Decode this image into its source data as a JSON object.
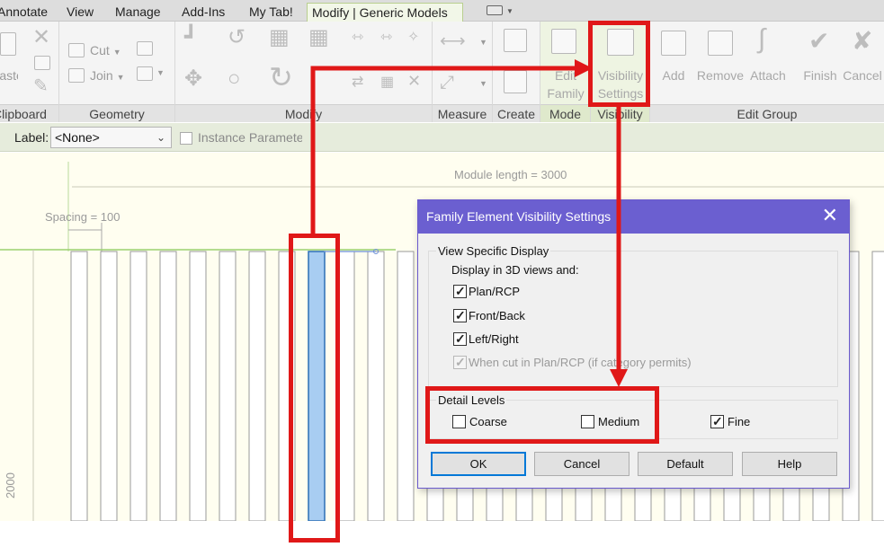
{
  "ribbon_tabs": [
    {
      "label": "Annotate"
    },
    {
      "label": "View"
    },
    {
      "label": "Manage"
    },
    {
      "label": "Add-Ins"
    },
    {
      "label": "My Tab!"
    },
    {
      "label": "Modify | Generic Models",
      "active": true
    }
  ],
  "ribbon": {
    "panels": {
      "clipboard": "Clipboard",
      "geometry": "Geometry",
      "modify": "Modify",
      "measure": "Measure",
      "create": "Create",
      "mode": "Mode",
      "visibility": "Visibility",
      "edit_group": "Edit Group"
    },
    "buttons": {
      "paste": "Paste",
      "cut": "Cut",
      "join": "Join",
      "edit_family_1": "Edit",
      "edit_family_2": "Family",
      "visibility_settings_1": "Visibility",
      "visibility_settings_2": "Settings",
      "add": "Add",
      "remove": "Remove",
      "attach": "Attach",
      "finish": "Finish",
      "cancel": "Cancel"
    }
  },
  "options_bar": {
    "label_caption": "Label:",
    "label_value": "<None>",
    "instance_parameter": "Instance Parameter"
  },
  "canvas": {
    "module_length": "Module length = 3000",
    "spacing": "Spacing = 100",
    "height_dim": "2000"
  },
  "dialog": {
    "title": "Family Element Visibility Settings",
    "view_specific": {
      "group_label": "View Specific Display",
      "display_caption": "Display in 3D views and:",
      "options": [
        {
          "label": "Plan/RCP",
          "checked": true,
          "enabled": true
        },
        {
          "label": "Front/Back",
          "checked": true,
          "enabled": true
        },
        {
          "label": "Left/Right",
          "checked": true,
          "enabled": true
        },
        {
          "label": "When cut in Plan/RCP (if category permits)",
          "checked": true,
          "enabled": false
        }
      ]
    },
    "detail_levels": {
      "group_label": "Detail Levels",
      "options": [
        {
          "label": "Coarse",
          "checked": false
        },
        {
          "label": "Medium",
          "checked": false
        },
        {
          "label": "Fine",
          "checked": true
        }
      ]
    },
    "buttons": {
      "ok": "OK",
      "cancel": "Cancel",
      "default": "Default",
      "help": "Help"
    }
  },
  "colors": {
    "accent_red": "#e01818",
    "dialog_title": "#6b5fd0",
    "selected_element": "#a8cdf2",
    "canvas_bg": "#fffef0"
  }
}
